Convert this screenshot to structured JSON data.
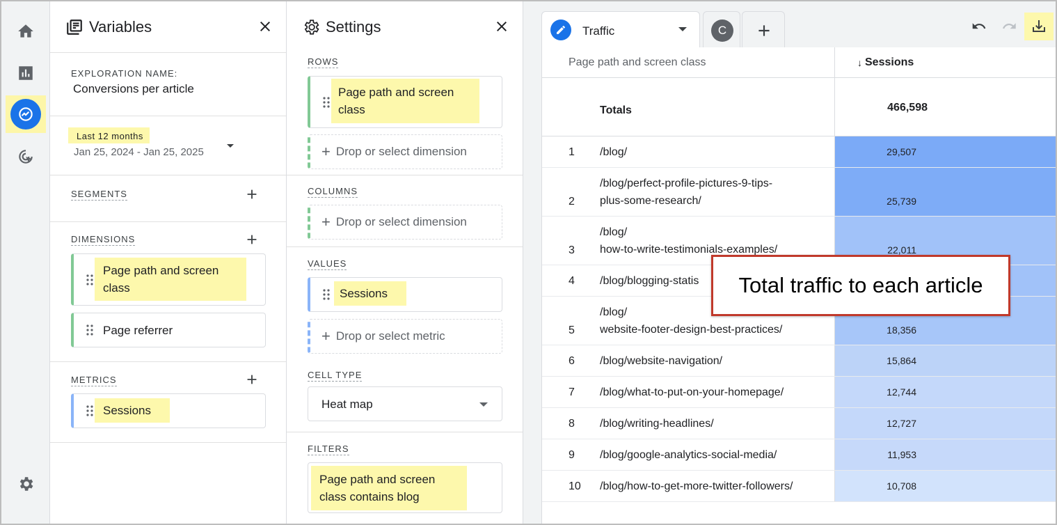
{
  "variables_panel": {
    "title": "Variables",
    "exploration_name_label": "EXPLORATION NAME:",
    "exploration_name": "Conversions per article",
    "date_preset": "Last 12 months",
    "date_range": "Jan 25, 2024 - Jan 25, 2025",
    "segments_label": "SEGMENTS",
    "dimensions_label": "DIMENSIONS",
    "dimensions": [
      "Page path and screen class",
      "Page referrer"
    ],
    "metrics_label": "METRICS",
    "metrics": [
      "Sessions"
    ]
  },
  "settings_panel": {
    "title": "Settings",
    "rows_label": "ROWS",
    "rows_item": "Page path and screen class",
    "drop_dimension": "Drop or select dimension",
    "columns_label": "COLUMNS",
    "values_label": "VALUES",
    "values_item": "Sessions",
    "drop_metric": "Drop or select metric",
    "cell_type_label": "CELL TYPE",
    "cell_type": "Heat map",
    "filters_label": "FILTERS",
    "filter_item": "Page path and screen class contains blog"
  },
  "tabs": {
    "active": "Traffic",
    "secondary_badge": "C"
  },
  "colors": {
    "accent": "#1a73e8",
    "highlight": "#fdf8ac",
    "heat_high": "#7baaf7",
    "heat_low": "#d2e3fc"
  },
  "table": {
    "dimension_header": "Page path and screen class",
    "metric_header": "Sessions",
    "sort_indicator": "↓",
    "totals_label": "Totals",
    "totals_value": "466,598",
    "rows": [
      {
        "n": "1",
        "path": "/blog/",
        "value": "29,507"
      },
      {
        "n": "2",
        "path": "/blog/perfect-profile-pictures-9-tips-plus-some-research/",
        "path_line1": "/blog/perfect-profile-pictures-9-tips-",
        "path_line2": "plus-some-research/",
        "value": "25,739"
      },
      {
        "n": "3",
        "path_line1": "/blog/",
        "path_line2": "how-to-write-testimonials-examples/",
        "value": "22,011"
      },
      {
        "n": "4",
        "path": "/blog/blogging-statis",
        "value": ""
      },
      {
        "n": "5",
        "path_line1": "/blog/",
        "path_line2": "website-footer-design-best-practices/",
        "value": "18,356"
      },
      {
        "n": "6",
        "path": "/blog/website-navigation/",
        "value": "15,864"
      },
      {
        "n": "7",
        "path": "/blog/what-to-put-on-your-homepage/",
        "value": "12,744"
      },
      {
        "n": "8",
        "path": "/blog/writing-headlines/",
        "value": "12,727"
      },
      {
        "n": "9",
        "path": "/blog/google-analytics-social-media/",
        "value": "11,953"
      },
      {
        "n": "10",
        "path": "/blog/how-to-get-more-twitter-followers/",
        "value": "10,708"
      }
    ]
  },
  "callout": "Total traffic to each article"
}
